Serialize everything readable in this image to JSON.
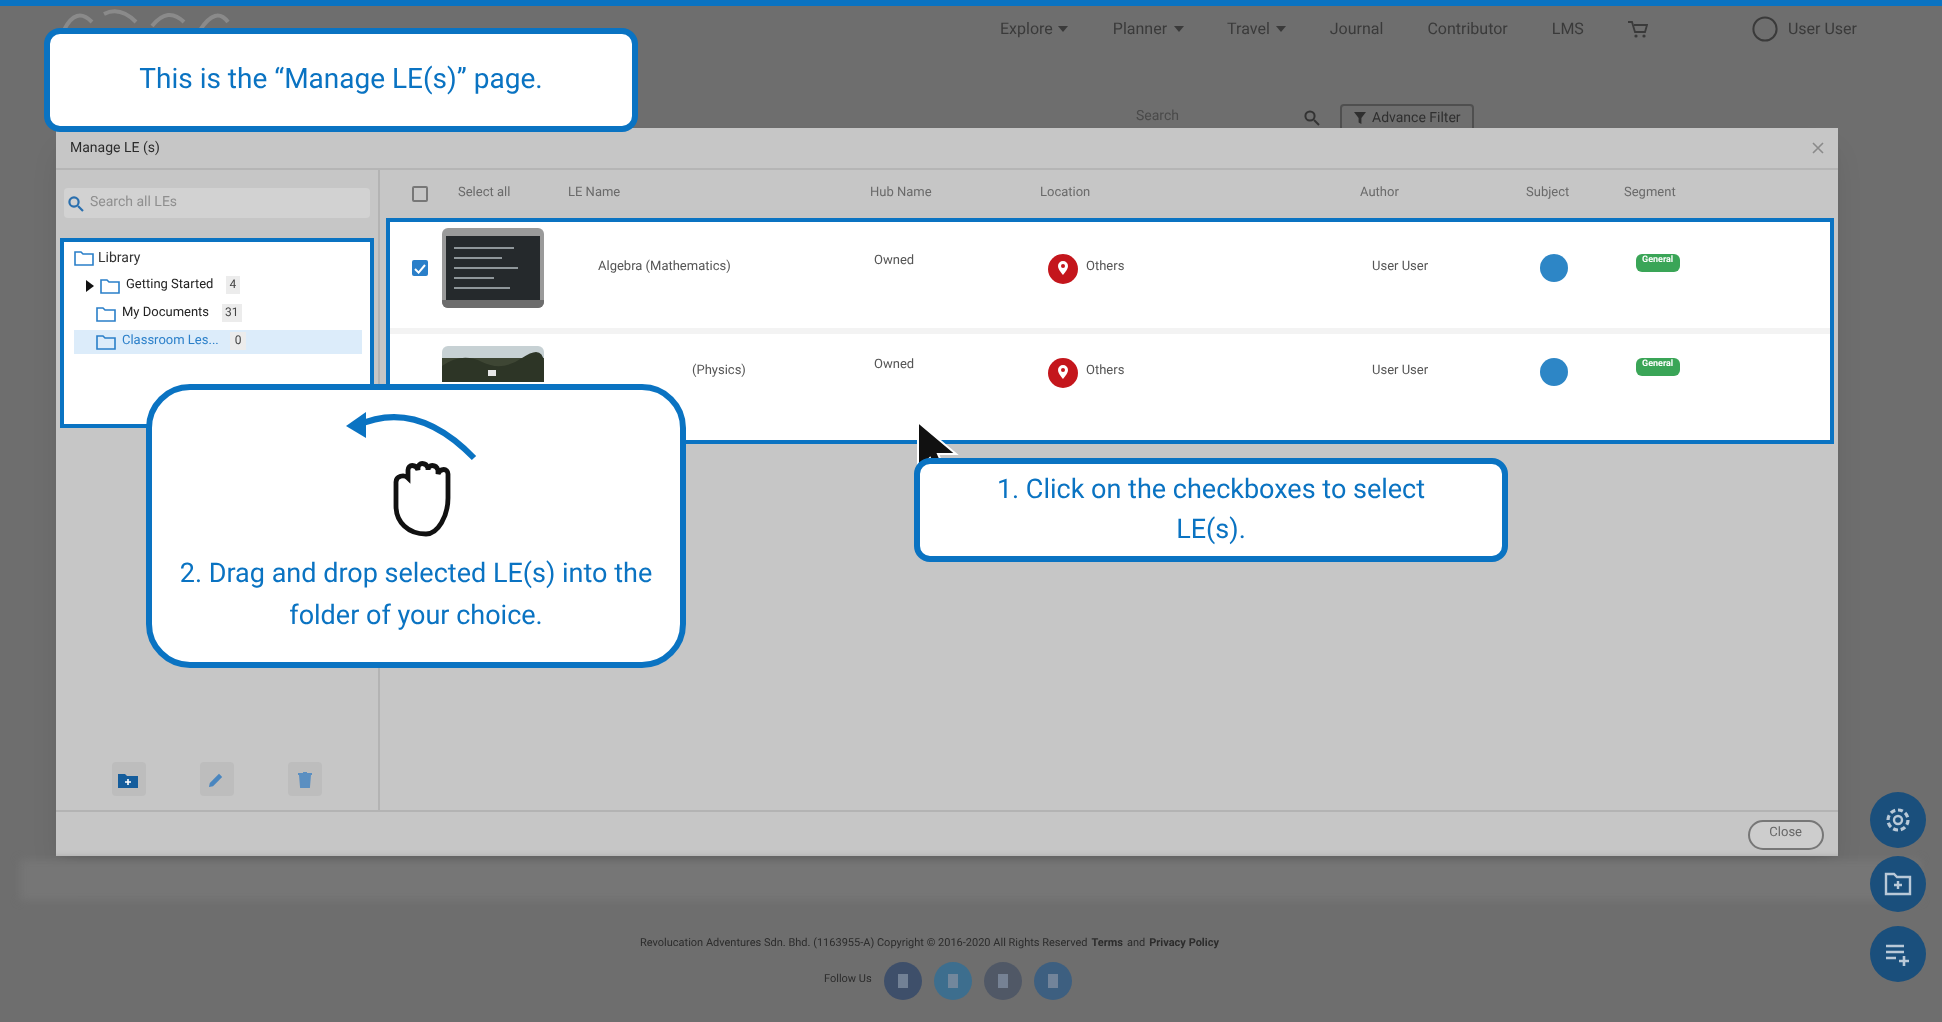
{
  "nav": {
    "items": [
      {
        "label": "Explore",
        "dropdown": true
      },
      {
        "label": "Planner",
        "dropdown": true
      },
      {
        "label": "Travel",
        "dropdown": true
      },
      {
        "label": "Journal",
        "dropdown": false
      },
      {
        "label": "Contributor",
        "dropdown": false
      },
      {
        "label": "LMS",
        "dropdown": false
      }
    ],
    "user": "User User"
  },
  "toolbar": {
    "search_placeholder": "Search",
    "filter_button": "Advance Filter"
  },
  "modal": {
    "title": "Manage LE (s)",
    "search_placeholder": "Search all LEs",
    "tree": {
      "label": "Library",
      "children": [
        {
          "label": "Getting Started",
          "count": "4",
          "expandable": true,
          "selected": false
        },
        {
          "label": "My Documents",
          "count": "31",
          "expandable": false,
          "selected": false
        },
        {
          "label": "Classroom Les...",
          "count": "0",
          "expandable": false,
          "selected": true
        }
      ]
    },
    "select_all": {
      "label": "Select all",
      "checked": false
    },
    "columns": [
      "LE Name",
      "Hub Name",
      "Location",
      "Author",
      "Subject",
      "Segment"
    ],
    "rows": [
      {
        "checked": true,
        "name": "Algebra (Mathematics)",
        "hub": "Owned",
        "location": "Others",
        "author": "User User",
        "segment": "General"
      },
      {
        "name": "(Physics)",
        "hub": "Owned",
        "location": "Others",
        "author": "User User",
        "segment": "General"
      }
    ],
    "close_button": "Close"
  },
  "callouts": [
    "This is the “Manage LE(s)” page.",
    "1. Click on the checkboxes to select LE(s).",
    "2. Drag and drop selected LE(s) into the folder of your choice."
  ],
  "footer": {
    "copyright": "Revolucation Adventures Sdn. Bhd. (1163955-A) Copyright © 2016-2020 All Rights Reserved",
    "terms_link": "Terms",
    "conjunction": "and",
    "privacy_link": "Privacy Policy",
    "follow_label": "Follow Us"
  }
}
